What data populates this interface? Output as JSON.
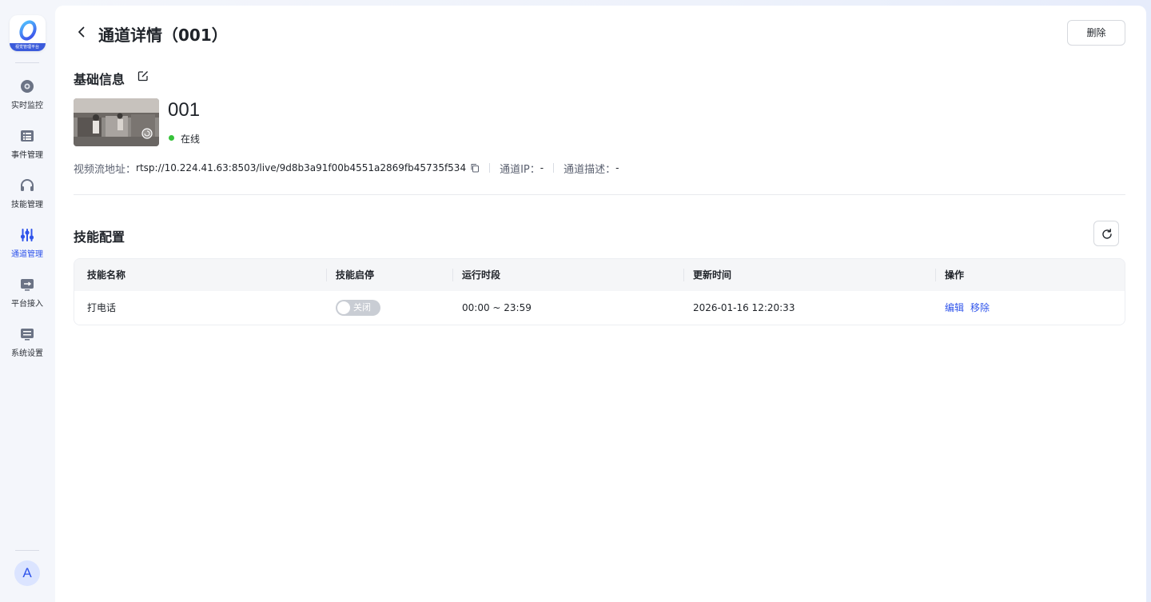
{
  "app": {
    "logo_text": "视觉管理平台"
  },
  "sidebar": {
    "items": [
      {
        "label": "实时监控",
        "icon": "camera-icon"
      },
      {
        "label": "事件管理",
        "icon": "list-icon"
      },
      {
        "label": "技能管理",
        "icon": "headset-icon"
      },
      {
        "label": "通道管理",
        "icon": "sliders-icon",
        "active": true
      },
      {
        "label": "平台接入",
        "icon": "platform-icon"
      },
      {
        "label": "系统设置",
        "icon": "settings-icon"
      }
    ],
    "avatar": "A"
  },
  "header": {
    "title": "通道详情（001）",
    "delete_label": "删除"
  },
  "basic_info": {
    "title": "基础信息",
    "channel_name": "001",
    "status": "在线",
    "status_color": "#36c23a",
    "stream_label": "视频流地址：",
    "stream_value": "rtsp://10.224.41.63:8503/live/9d8b3a91f00b4551a2869fb45735f534",
    "ip_label": "通道IP：",
    "ip_value": "-",
    "desc_label": "通道描述：",
    "desc_value": "-"
  },
  "skills": {
    "title": "技能配置",
    "columns": [
      "技能名称",
      "技能启停",
      "运行时段",
      "更新时间",
      "操作"
    ],
    "rows": [
      {
        "name": "打电话",
        "toggle_label": "关闭",
        "enabled": false,
        "period": "00:00 ~ 23:59",
        "updated": "2026-01-16 12:20:33",
        "actions": [
          "编辑",
          "移除"
        ]
      }
    ]
  },
  "colors": {
    "accent": "#2f54eb",
    "online": "#36c23a"
  }
}
